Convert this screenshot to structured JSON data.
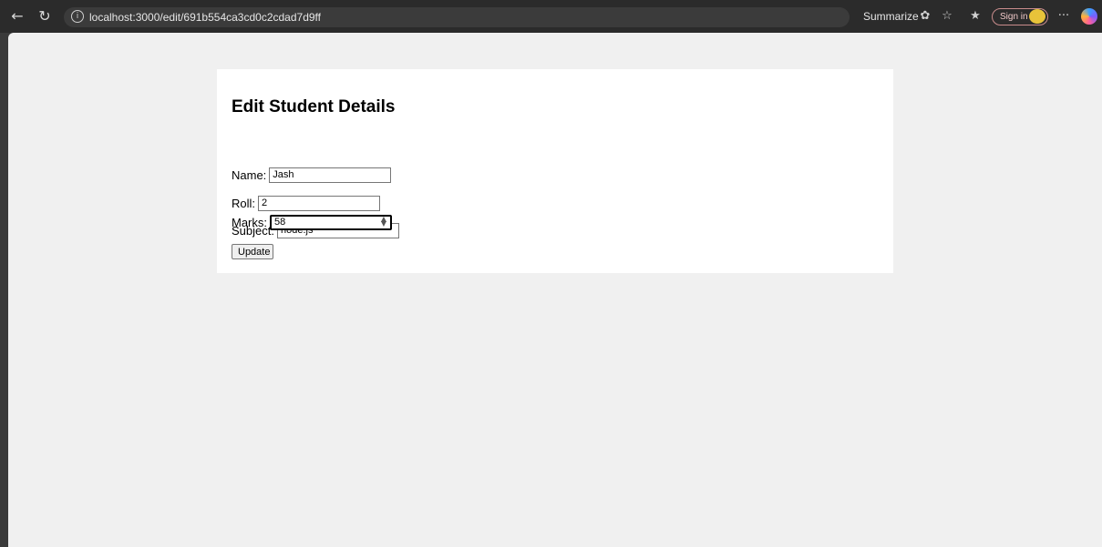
{
  "browser": {
    "back_icon": "back-arrow-icon",
    "refresh_icon": "refresh-icon",
    "url": "localhost:3000/edit/691b554ca3cd0c2cdad7d9ff",
    "summarize_label": "Summarize",
    "sign_in_label": "Sign in",
    "more_label": "···"
  },
  "form": {
    "title": "Edit Student Details",
    "fields": [
      {
        "label": "Name:",
        "value": "Jash"
      },
      {
        "label": "Roll:",
        "value": "2"
      },
      {
        "label": "Subject:",
        "value": "node.js"
      },
      {
        "label": "Marks:",
        "value": "58"
      }
    ],
    "submit_label": "Update"
  }
}
